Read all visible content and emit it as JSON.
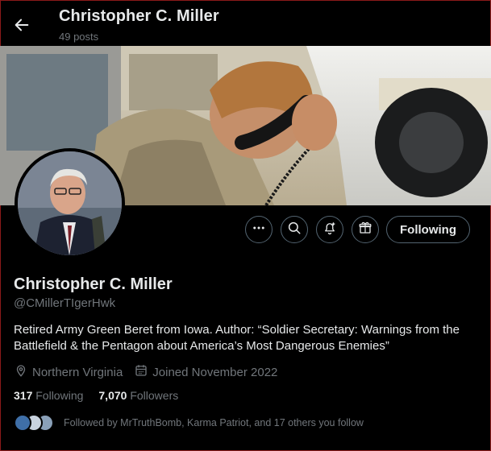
{
  "header": {
    "title": "Christopher C. Miller",
    "posts_count": "49 posts"
  },
  "profile": {
    "name": "Christopher C. Miller",
    "handle": "@CMillerTIgerHwk",
    "bio": "Retired Army Green Beret from Iowa. Author: “Soldier Secretary: Warnings from the Battlefield & the Pentagon about America’s Most Dangerous Enemies”",
    "location": "Northern Virginia",
    "joined": "Joined November 2022",
    "following_count": "317",
    "following_label": "Following",
    "followers_count": "7,070",
    "followers_label": "Followers",
    "followed_by": "Followed by MrTruthBomb, Karma Patriot, and 17 others you follow"
  },
  "actions": {
    "follow_button": "Following",
    "icons": [
      "more-icon",
      "search-icon",
      "notification-bell-icon",
      "gift-icon"
    ]
  },
  "colors": {
    "background": "#000000",
    "text": "#e7e9ea",
    "secondary_text": "#71767b",
    "border": "#536471"
  }
}
